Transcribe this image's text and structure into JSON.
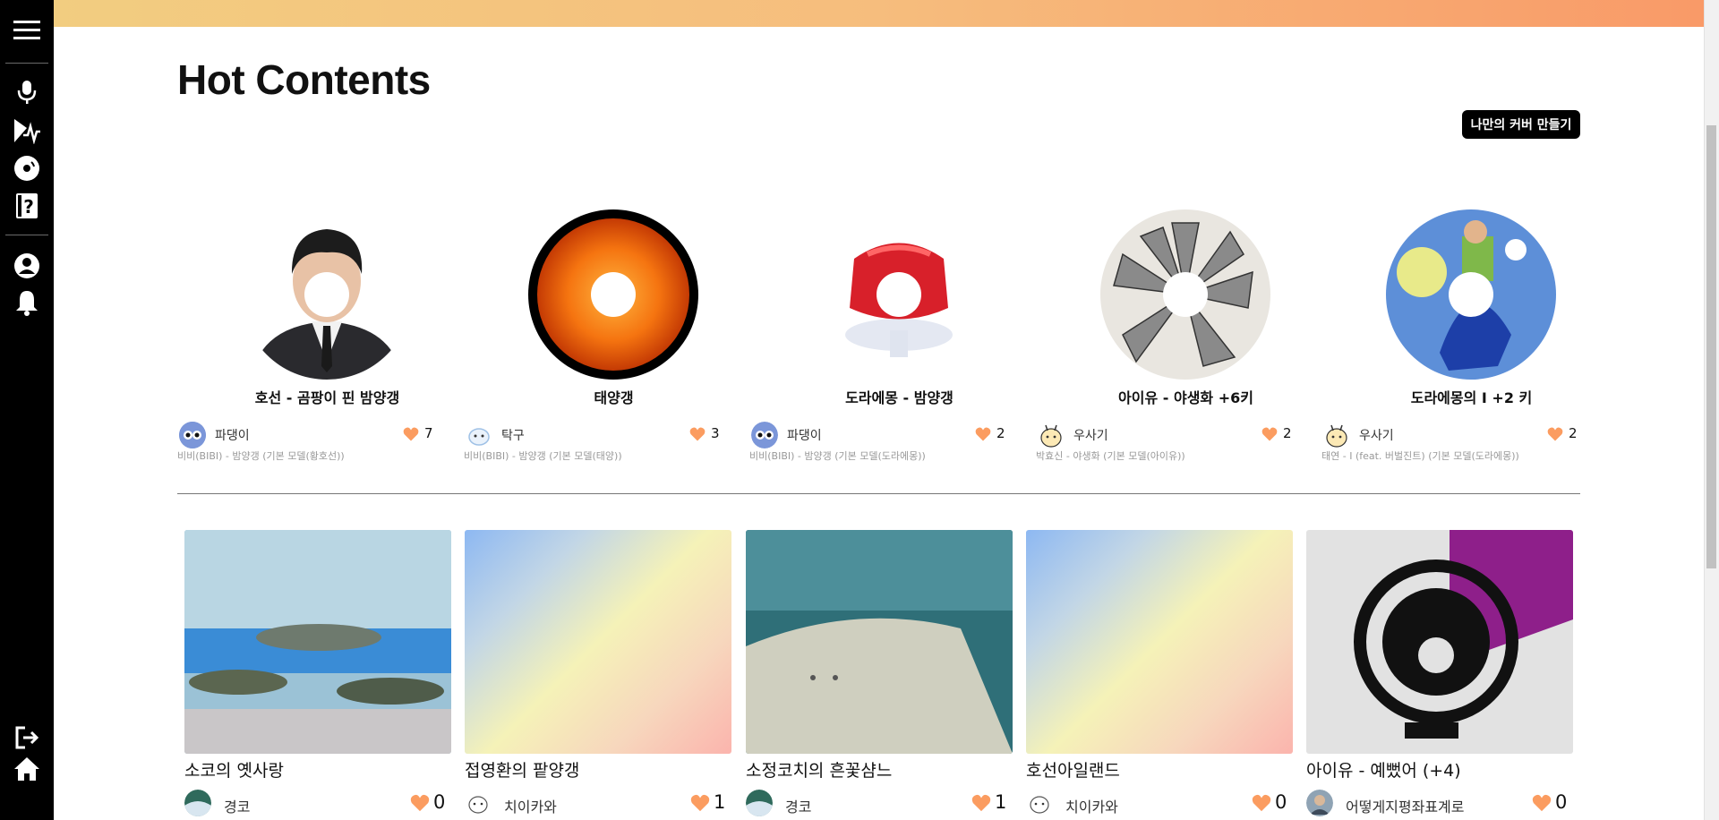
{
  "sidebar": {
    "icons": [
      "hamburger-menu-icon",
      "microphone-icon",
      "voice-model-icon",
      "music-disc-icon",
      "help-book-icon",
      "profile-icon",
      "notification-bell-icon",
      "logout-icon",
      "home-icon"
    ]
  },
  "header": {
    "title": "Hot Contents",
    "cover_button": "나만의 커버 만들기"
  },
  "colors": {
    "accent_orange": "#f7a36b",
    "heart": "#fb9c60",
    "sidebar_bg": "#000000"
  },
  "disc_cards": [
    {
      "title": "호선 - 곰팡이 핀 밤양갱",
      "user": "파댕이",
      "likes": "7",
      "subtitle": "비비(BIBI) - 밤양갱 (기본 모델(황호선))"
    },
    {
      "title": "태양갱",
      "user": "탁구",
      "likes": "3",
      "subtitle": "비비(BIBI) - 밤양갱 (기본 모델(태양))"
    },
    {
      "title": "도라에몽 - 밤양갱",
      "user": "파댕이",
      "likes": "2",
      "subtitle": "비비(BIBI) - 밤양갱 (기본 모델(도라에몽))"
    },
    {
      "title": "아이유 - 야생화 +6키",
      "user": "우사기",
      "likes": "2",
      "subtitle": "박효신 - 야생화 (기본 모델(아이유))"
    },
    {
      "title": "도라에몽의 I +2 키",
      "user": "우사기",
      "likes": "2",
      "subtitle": "태연 - I (feat. 버벌진트) (기본 모델(도라에몽))"
    }
  ],
  "square_cards": [
    {
      "title": "소코의 옛사랑",
      "user": "경코",
      "likes": "0"
    },
    {
      "title": "접영환의 팥양갱",
      "user": "치이카와",
      "likes": "1"
    },
    {
      "title": "소정코치의 흔꽃샴느",
      "user": "경코",
      "likes": "1"
    },
    {
      "title": "호선아일랜드",
      "user": "치이카와",
      "likes": "0"
    },
    {
      "title": "아이유 - 예뻤어 (+4)",
      "user": "어떻게지평좌표계로",
      "likes": "0"
    }
  ]
}
